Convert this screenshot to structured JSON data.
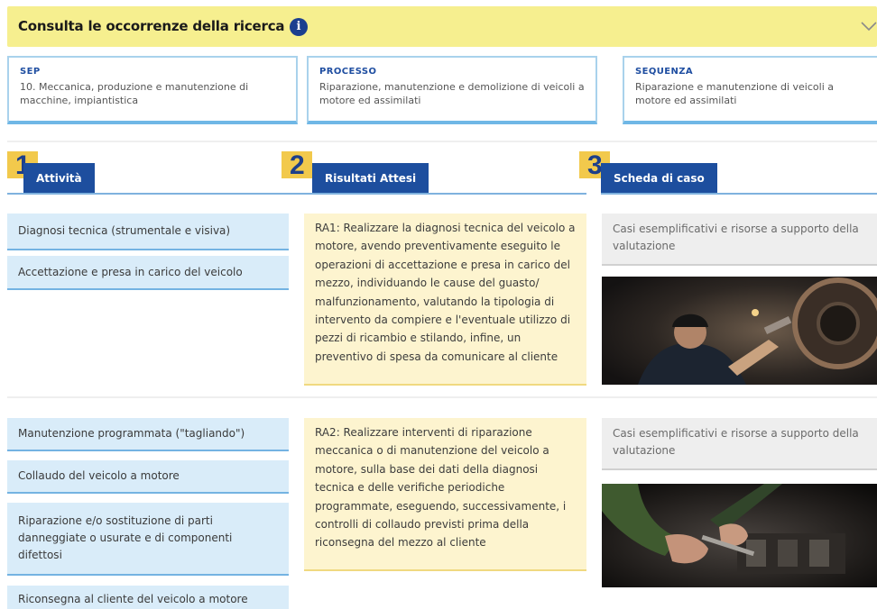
{
  "header": {
    "title": "Consulta le occorrenze della ricerca",
    "info_icon": "info-icon",
    "chevron_icon": "chevron-down-icon"
  },
  "cards": [
    {
      "label": "SEP",
      "value": "10. Meccanica, produzione e manutenzione di macchine, impiantistica"
    },
    {
      "label": "PROCESSO",
      "value": "Riparazione, manutenzione e demolizione di veicoli a motore ed assimilati"
    },
    {
      "label": "SEQUENZA",
      "value": "Riparazione e manutenzione di veicoli a motore ed assimilati"
    }
  ],
  "columns": [
    {
      "number": "1",
      "title": "Attività"
    },
    {
      "number": "2",
      "title": "Risultati Attesi"
    },
    {
      "number": "3",
      "title": "Scheda di caso"
    }
  ],
  "groups": [
    {
      "activities": [
        "Diagnosi tecnica (strumentale e visiva)",
        "Accettazione e presa in carico del veicolo"
      ],
      "result": "RA1: Realizzare la diagnosi tecnica del veicolo a motore, avendo preventivamente eseguito le operazioni di accettazione e presa in carico del mezzo, individuando le cause del guasto/ malfunzionamento, valutando la tipologia di intervento da compiere e l'eventuale utilizzo di pezzi di ricambio e stilando, infine, un preventivo di spesa da comunicare al cliente",
      "case_text": "Casi esemplificativi e risorse a supporto della valutazione"
    },
    {
      "activities": [
        "Manutenzione programmata (\"tagliando\")",
        "Collaudo del veicolo a motore",
        "Riparazione e/o sostituzione di parti danneggiate o usurate e di componenti difettosi",
        "Riconsegna al cliente del veicolo a motore"
      ],
      "result": "RA2: Realizzare interventi di riparazione meccanica o di manutenzione del veicolo a motore, sulla base dei dati della diagnosi tecnica e delle verifiche periodiche programmate, eseguendo, successivamente, i controlli di collaudo previsti prima della riconsegna del mezzo al cliente",
      "case_text": "Casi esemplificativi e risorse a supporto della valutazione"
    }
  ],
  "colors": {
    "header_bg": "#f6ef8f",
    "tab_blue": "#1d4e9e",
    "number_yellow": "#f2c94c",
    "activity_bg": "#d9ecf9",
    "result_bg": "#fdf4cf",
    "case_bg": "#eeeeee"
  }
}
